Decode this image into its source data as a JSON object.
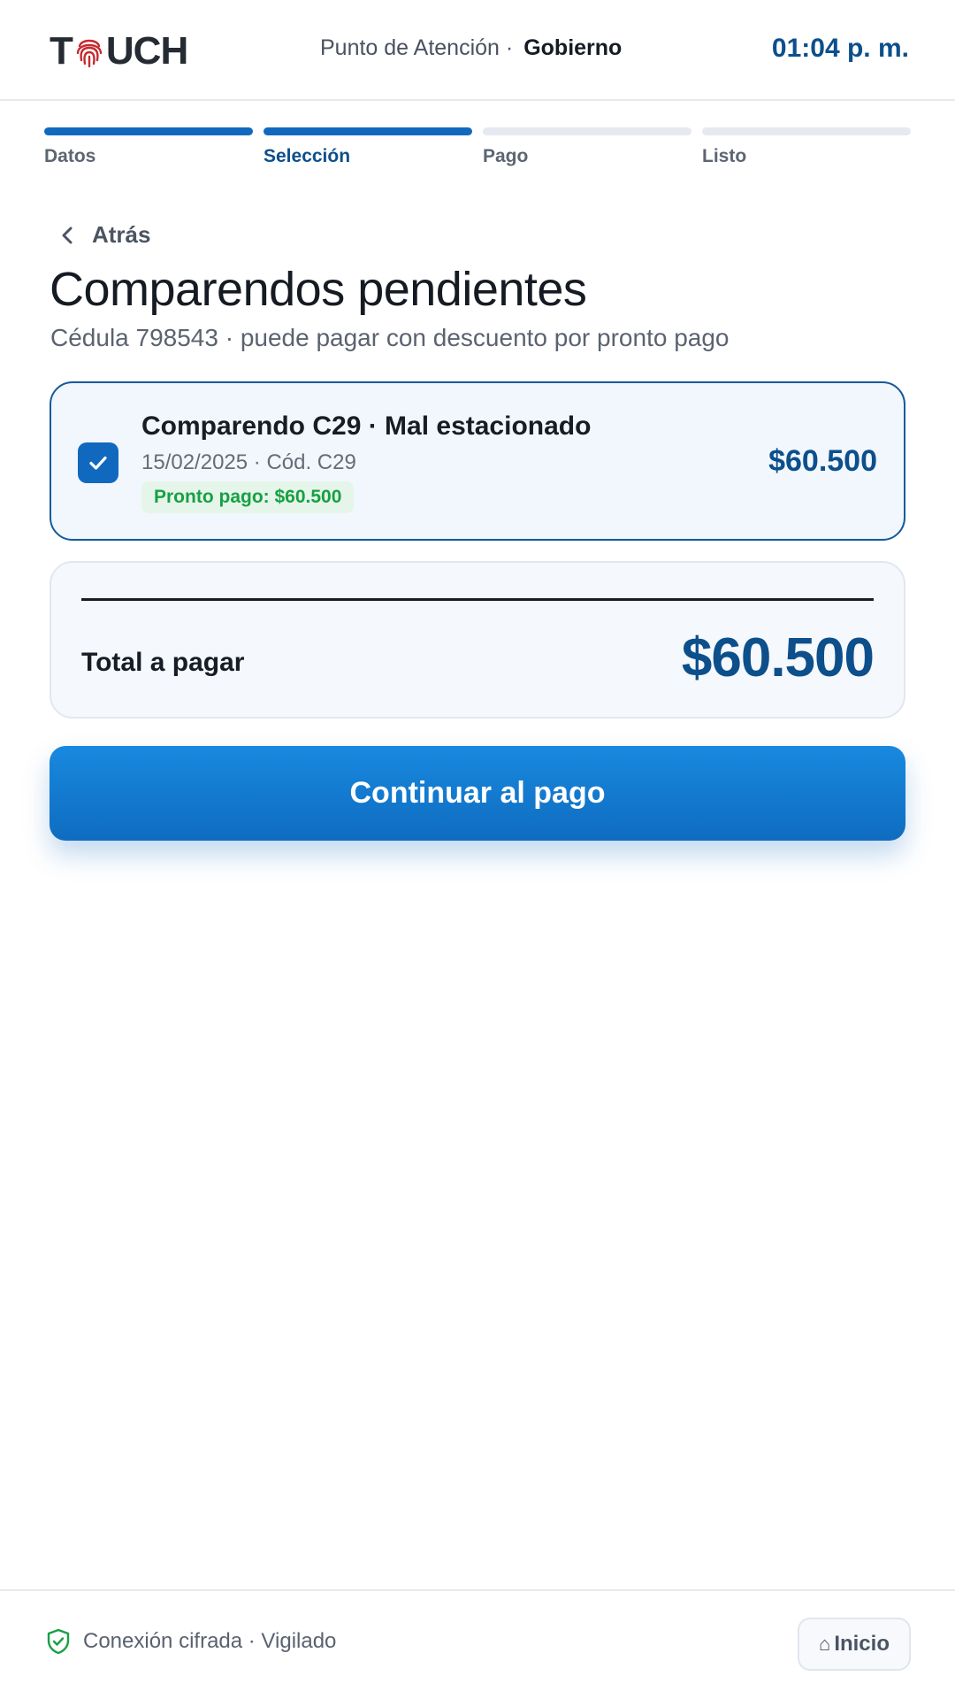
{
  "header": {
    "logo_left": "T",
    "logo_right": "UCH",
    "location_label": "Punto de Atención ·",
    "location_name": "Gobierno",
    "time": "01:04 p. m."
  },
  "steps": [
    {
      "label": "Datos",
      "state": "done"
    },
    {
      "label": "Selección",
      "state": "current"
    },
    {
      "label": "Pago",
      "state": "pending"
    },
    {
      "label": "Listo",
      "state": "pending"
    }
  ],
  "back_label": "Atrás",
  "page": {
    "title": "Comparendos pendientes",
    "subtitle": "Cédula 798543 · puede pagar con descuento por pronto pago"
  },
  "tickets": [
    {
      "checked": true,
      "name": "Comparendo C29 · Mal estacionado",
      "meta": "15/02/2025 · Cód. C29",
      "badge": "Pronto pago: $60.500",
      "amount": "$60.500"
    }
  ],
  "summary": {
    "total_label": "Total a pagar",
    "total_amount": "$60.500"
  },
  "cta_label": "Continuar al pago",
  "footer": {
    "secure_text": "Conexión cifrada · Vigilado",
    "home_icon": "⌂",
    "home_label": "Inicio"
  },
  "colors": {
    "primary": "#1169bf",
    "primary_dark": "#0d4f8b",
    "logo_red": "#c62a2f",
    "success": "#17a043"
  },
  "icons": {
    "logo": "fingerprint-icon",
    "back": "chevron-left-icon",
    "checkbox": "checkmark-icon",
    "secure": "shield-check-icon",
    "home": "home-icon"
  }
}
